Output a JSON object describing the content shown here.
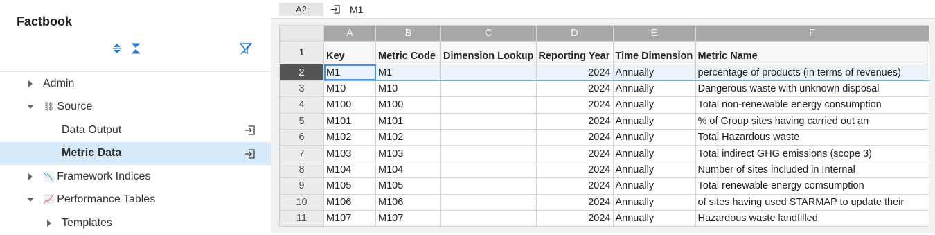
{
  "sidebar": {
    "title": "Factbook",
    "tools": [
      "expand-all-icon",
      "collapse-all-icon",
      "clear-filter-icon"
    ],
    "items": [
      {
        "label": "Admin",
        "level": 0,
        "state": "collapsed"
      },
      {
        "label": "Source",
        "level": 0,
        "state": "expanded",
        "icon": "⛓"
      },
      {
        "label": "Data Output",
        "level": 1,
        "state": "leaf",
        "action_icon": "open-icon"
      },
      {
        "label": "Metric Data",
        "level": 1,
        "state": "leaf",
        "selected": true,
        "action_icon": "open-icon"
      },
      {
        "label": "Framework Indices",
        "level": 0,
        "state": "collapsed",
        "icon": "📉"
      },
      {
        "label": "Performance Tables",
        "level": 0,
        "state": "expanded",
        "icon": "📈"
      },
      {
        "label": "Templates",
        "level": 1,
        "state": "collapsed"
      }
    ]
  },
  "formula_bar": {
    "cell_ref": "A2",
    "value": "M1"
  },
  "grid": {
    "columns": [
      "A",
      "B",
      "C",
      "D",
      "E",
      "F"
    ],
    "row_numbers": [
      "1",
      "2",
      "3",
      "4",
      "5",
      "6",
      "7",
      "8",
      "9",
      "10",
      "11"
    ],
    "headers": [
      "Key",
      "Metric Code",
      "Dimension Lookup",
      "Reporting Year",
      "Time Dimension",
      "Metric Name"
    ],
    "rows": [
      [
        "M1",
        "M1",
        "",
        "2024",
        "Annually",
        "percentage of products (in terms of revenues)"
      ],
      [
        "M10",
        "M10",
        "",
        "2024",
        "Annually",
        "Dangerous waste with unknown disposal"
      ],
      [
        "M100",
        "M100",
        "",
        "2024",
        "Annually",
        "Total non-renewable energy consumption"
      ],
      [
        "M101",
        "M101",
        "",
        "2024",
        "Annually",
        "% of Group sites having carried out an"
      ],
      [
        "M102",
        "M102",
        "",
        "2024",
        "Annually",
        "Total Hazardous waste"
      ],
      [
        "M103",
        "M103",
        "",
        "2024",
        "Annually",
        "Total indirect GHG emissions (scope 3)"
      ],
      [
        "M104",
        "M104",
        "",
        "2024",
        "Annually",
        "Number of sites included in Internal"
      ],
      [
        "M105",
        "M105",
        "",
        "2024",
        "Annually",
        "Total renewable energy comsumption"
      ],
      [
        "M106",
        "M106",
        "",
        "2024",
        "Annually",
        "of sites having used STARMAP to update their"
      ],
      [
        "M107",
        "M107",
        "",
        "2024",
        "Annually",
        "Hazardous waste landfilled"
      ]
    ],
    "active_row": 2
  },
  "colors": {
    "selected_bg": "#d6e9f8",
    "accent": "#2b7bd6",
    "column_header": "#a8a8a8",
    "active_row_number": "#555555"
  }
}
